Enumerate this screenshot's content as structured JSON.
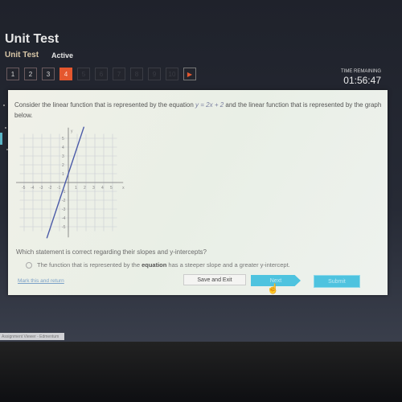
{
  "header": {
    "title": "Unit Test",
    "subtitle": "Unit Test",
    "status": "Active",
    "time_label": "TIME REMAINING",
    "time_value": "01:56:47"
  },
  "pager": {
    "pages": [
      {
        "label": "1",
        "state": "visited"
      },
      {
        "label": "2",
        "state": "visited"
      },
      {
        "label": "3",
        "state": "visited"
      },
      {
        "label": "4",
        "state": "active"
      },
      {
        "label": "5",
        "state": "future"
      },
      {
        "label": "6",
        "state": "future"
      },
      {
        "label": "7",
        "state": "future"
      },
      {
        "label": "8",
        "state": "future"
      },
      {
        "label": "9",
        "state": "future"
      },
      {
        "label": "10",
        "state": "future"
      }
    ],
    "next_icon": "play-icon",
    "active_color": "#e4572e"
  },
  "question": {
    "text_before": "Consider the linear function that is represented by the equation ",
    "equation": "y = 2x + 2",
    "text_after": " and the linear function that is represented by the graph below.",
    "prompt": "Which statement is correct regarding their slopes and y-intercepts?",
    "option_prefix": "The function that is represented by the ",
    "option_bold": "equation",
    "option_suffix": " has a steeper slope and a greater y-intercept."
  },
  "graph": {
    "x_label": "x",
    "y_label": "y",
    "x_ticks": [
      "-5",
      "-4",
      "-3",
      "-2",
      "-1",
      "1",
      "2",
      "3",
      "4",
      "5"
    ],
    "y_ticks": [
      "5",
      "4",
      "3",
      "2",
      "1",
      "-1",
      "-2",
      "-3",
      "-4",
      "-5"
    ],
    "line": {
      "slope": 3,
      "intercept": 1,
      "color": "#4a5aa8"
    },
    "range": [
      -6,
      6
    ]
  },
  "actions": {
    "mark": "Mark this and return",
    "save": "Save and Exit",
    "next": "Next",
    "submit": "Submit"
  },
  "taskbar": {
    "item": "Assignment Viewer - Edmentum"
  }
}
